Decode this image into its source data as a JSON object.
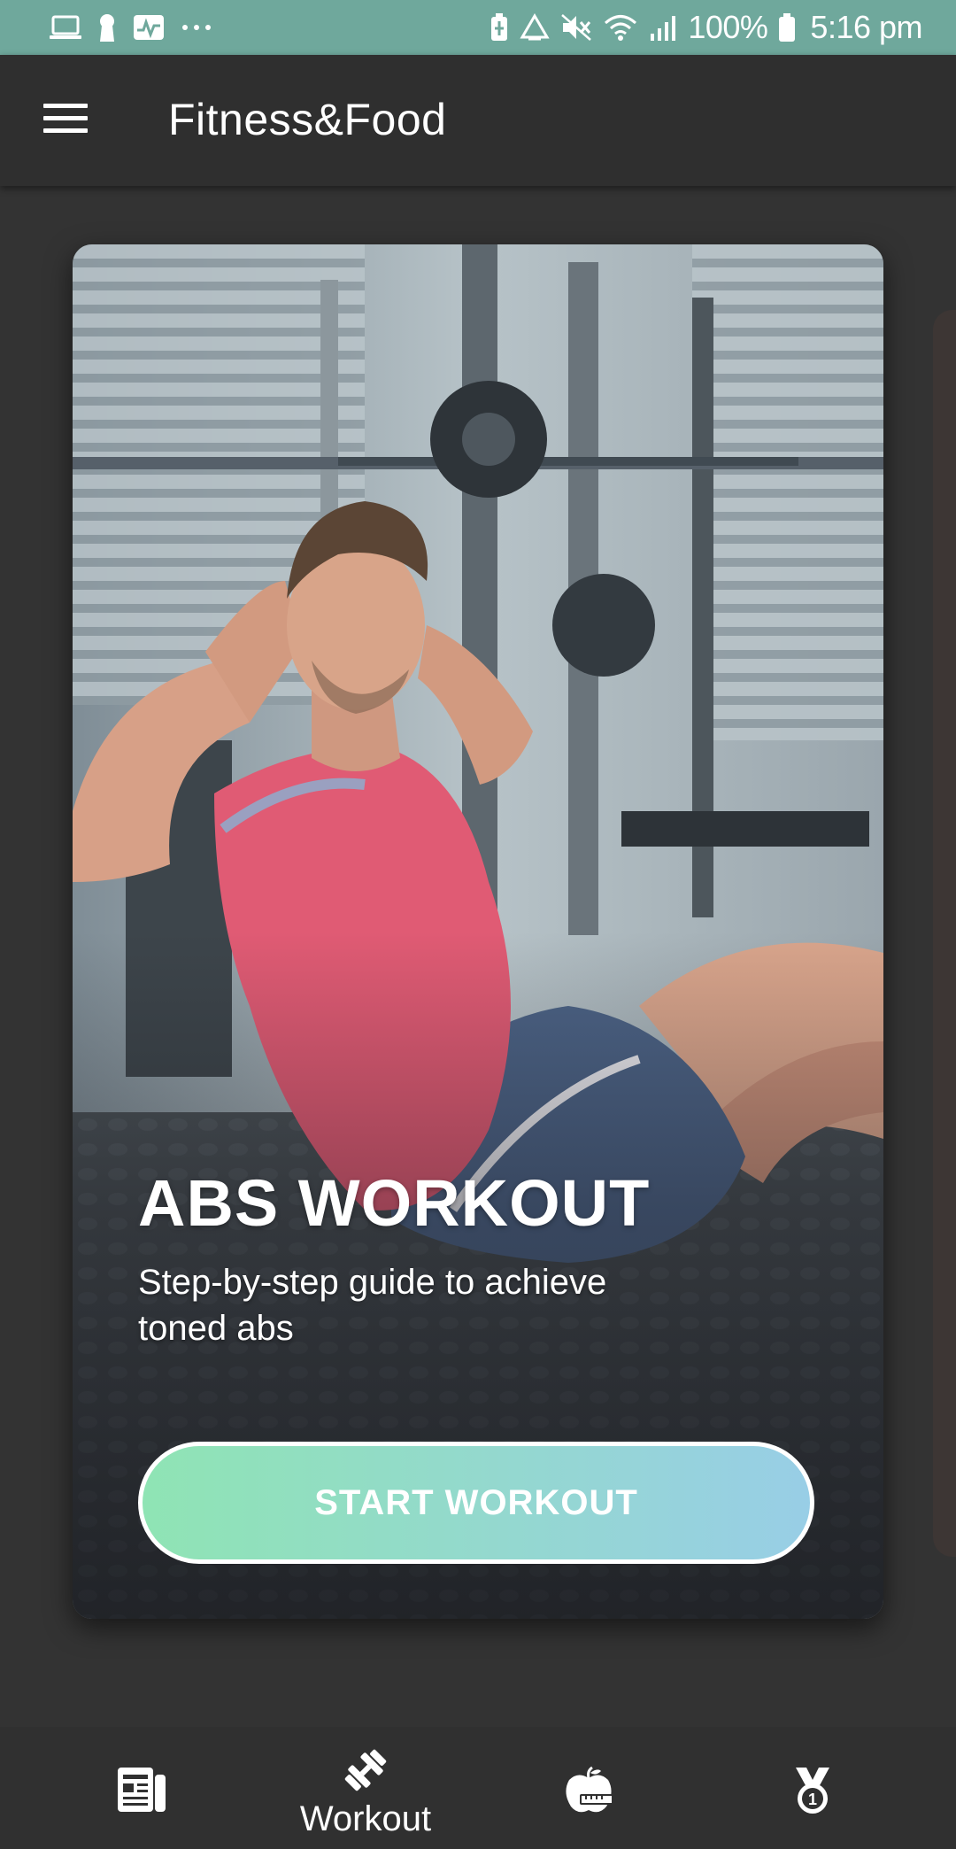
{
  "status_bar": {
    "left_icons": [
      "laptop-icon",
      "keyhole-icon",
      "activity-icon",
      "more-dots-icon"
    ],
    "right_icons": [
      "battery-saver-icon",
      "recycle-icon",
      "mute-icon",
      "wifi-icon",
      "signal-icon",
      "battery-icon"
    ],
    "battery": "100%",
    "time": "5:16 pm",
    "color": "#6fa89c"
  },
  "app_bar": {
    "menu_icon": "hamburger-menu-icon",
    "title": "Fitness&Food"
  },
  "card": {
    "image": "man-doing-sit-ups-in-gym-photo",
    "title": "ABS WORKOUT",
    "subtitle": "Step-by-step guide to achieve toned abs",
    "button_label": "START WORKOUT",
    "button_gradient": [
      "#8fe4b4",
      "#98cee6"
    ]
  },
  "bottom_nav": {
    "items": [
      {
        "icon": "news-icon",
        "label": ""
      },
      {
        "icon": "dumbbell-icon",
        "label": "Workout",
        "active": true
      },
      {
        "icon": "apple-measure-icon",
        "label": ""
      },
      {
        "icon": "medal-icon",
        "label": ""
      }
    ]
  }
}
